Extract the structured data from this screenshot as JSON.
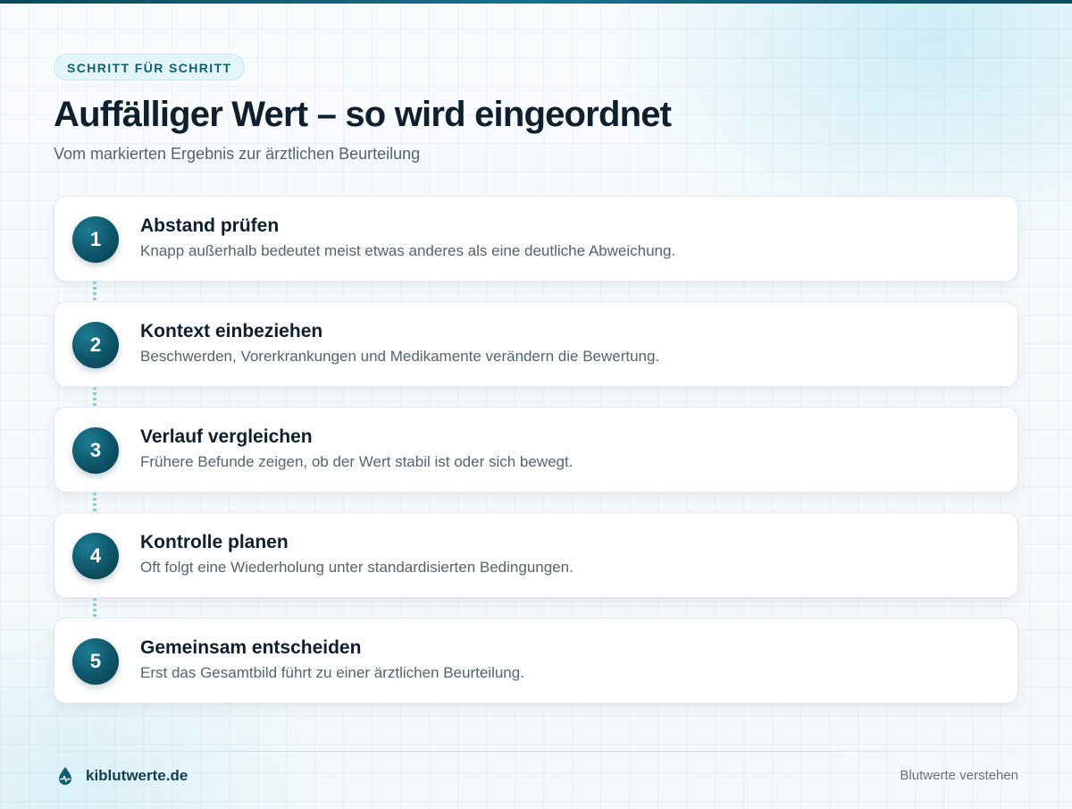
{
  "header": {
    "eyebrow": "SCHRITT FÜR SCHRITT",
    "title": "Auffälliger Wert – so wird eingeordnet",
    "subtitle": "Vom markierten Ergebnis zur ärztlichen Beurteilung"
  },
  "steps": [
    {
      "number": "1",
      "title": "Abstand prüfen",
      "description": "Knapp außerhalb bedeutet meist etwas anderes als eine deutliche Abweichung."
    },
    {
      "number": "2",
      "title": "Kontext einbeziehen",
      "description": "Beschwerden, Vorerkrankungen und Medikamente verändern die Bewertung."
    },
    {
      "number": "3",
      "title": "Verlauf vergleichen",
      "description": "Frühere Befunde zeigen, ob der Wert stabil ist oder sich bewegt."
    },
    {
      "number": "4",
      "title": "Kontrolle planen",
      "description": "Oft folgt eine Wiederholung unter standardisierten Bedingungen."
    },
    {
      "number": "5",
      "title": "Gemeinsam entscheiden",
      "description": "Erst das Gesamtbild führt zu einer ärztlichen Beurteilung."
    }
  ],
  "footer": {
    "brand": "kiblutwerte.de",
    "brand_icon": "blood-drop-pulse-icon",
    "tagline": "Blutwerte verstehen"
  },
  "colors": {
    "accent": "#0e5468",
    "accent_light": "#e3f5f8",
    "connector": "#7fcfe1",
    "text_primary": "#0f1f2e",
    "text_secondary": "#55646f"
  }
}
